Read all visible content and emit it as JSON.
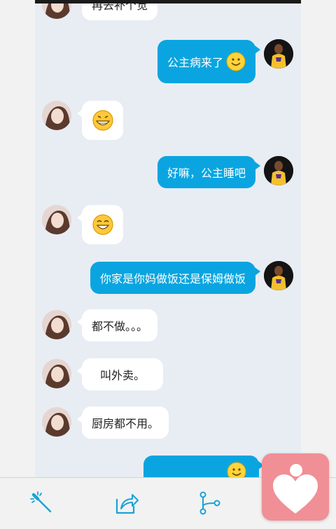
{
  "colors": {
    "chat_background": "#e8edf4",
    "outgoing_bubble": "#0aa5e0",
    "incoming_bubble": "#ffffff",
    "accent_icon": "#1aa2d6",
    "like_button": "#f08f96"
  },
  "messages": [
    {
      "side": "incoming",
      "text": "再去补个觉"
    },
    {
      "side": "outgoing",
      "text": "公主病来了",
      "emoji": "smile-emoji"
    },
    {
      "side": "incoming",
      "text": "",
      "emoji": "grin-emoji"
    },
    {
      "side": "outgoing",
      "text": "好嘛，公主睡吧"
    },
    {
      "side": "incoming",
      "text": "",
      "emoji": "laugh-emoji"
    },
    {
      "side": "outgoing",
      "text": "你家是你妈做饭还是保姆做饭"
    },
    {
      "side": "incoming",
      "text": "都不做。。。"
    },
    {
      "side": "incoming",
      "text": "叫外卖。"
    },
    {
      "side": "incoming",
      "text": "厨房都不用。"
    },
    {
      "side": "outgoing",
      "text": "",
      "emoji": "smile-emoji"
    }
  ],
  "toolbar": {
    "icons": [
      "magic-wand-icon",
      "share-icon",
      "branch-icon"
    ],
    "like_icon": "heart-person-icon"
  }
}
